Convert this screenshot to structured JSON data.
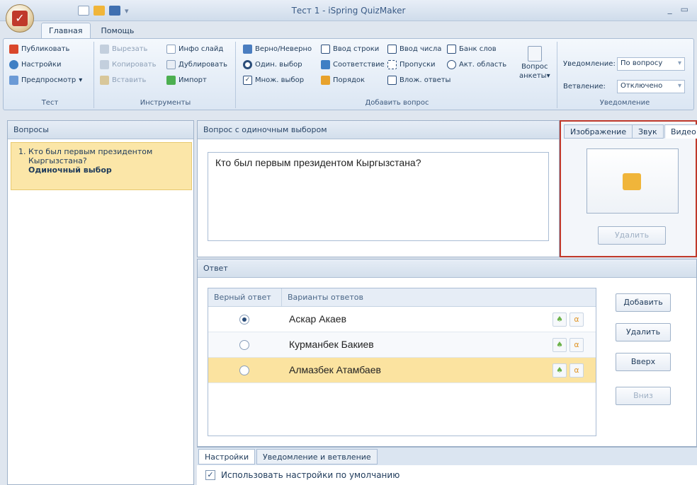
{
  "window": {
    "title": "Тест 1 - iSpring QuizMaker",
    "min": "_",
    "max": "▭"
  },
  "ribbon_tabs": [
    "Главная",
    "Помощь"
  ],
  "groups": {
    "test": {
      "label": "Тест",
      "publish": "Публиковать",
      "settings": "Настройки",
      "preview": "Предпросмотр"
    },
    "tools": {
      "label": "Инструменты",
      "cut": "Вырезать",
      "copy": "Копировать",
      "paste": "Вставить",
      "info_slide": "Инфо слайд",
      "duplicate": "Дублировать",
      "import": "Импорт"
    },
    "add_question": {
      "label": "Добавить вопрос",
      "true_false": "Верно/Неверно",
      "single": "Один. выбор",
      "multi": "Множ. выбор",
      "text_entry": "Ввод строки",
      "matching": "Соответствие",
      "sequence": "Порядок",
      "numeric": "Ввод числа",
      "fill_blanks": "Пропуски",
      "nested": "Влож. ответы",
      "word_bank": "Банк слов",
      "hotspot": "Акт. область",
      "survey_q1": "Вопрос",
      "survey_q2": "анкеты"
    },
    "feedback": {
      "label": "Уведомление",
      "feedback_label": "Уведомление:",
      "feedback_value": "По вопросу",
      "branching_label": "Ветвление:",
      "branching_value": "Отключено"
    }
  },
  "questions_panel": {
    "title": "Вопросы",
    "items": [
      {
        "line1": "1. Кто был первым президентом",
        "line2": "Кыргызстана?",
        "type": "Одиночный выбор"
      }
    ]
  },
  "question_panel": {
    "title": "Вопрос с одиночным выбором",
    "text": "Кто был первым президентом Кыргызстана?"
  },
  "media_panel": {
    "tabs": [
      "Изображение",
      "Звук",
      "Видео"
    ],
    "delete": "Удалить"
  },
  "answer_panel": {
    "title": "Ответ",
    "col_correct": "Верный ответ",
    "col_options": "Варианты ответов",
    "rows": [
      {
        "text": "Аскар Акаев",
        "correct": true
      },
      {
        "text": "Курманбек Бакиев",
        "correct": false
      },
      {
        "text": "Алмазбек Атамбаев",
        "correct": false
      }
    ],
    "buttons": {
      "add": "Добавить",
      "delete": "Удалить",
      "up": "Вверх",
      "down": "Вниз"
    }
  },
  "bottom": {
    "tabs": [
      "Настройки",
      "Уведомление и ветвление"
    ],
    "use_defaults": "Использовать настройки по умолчанию"
  }
}
